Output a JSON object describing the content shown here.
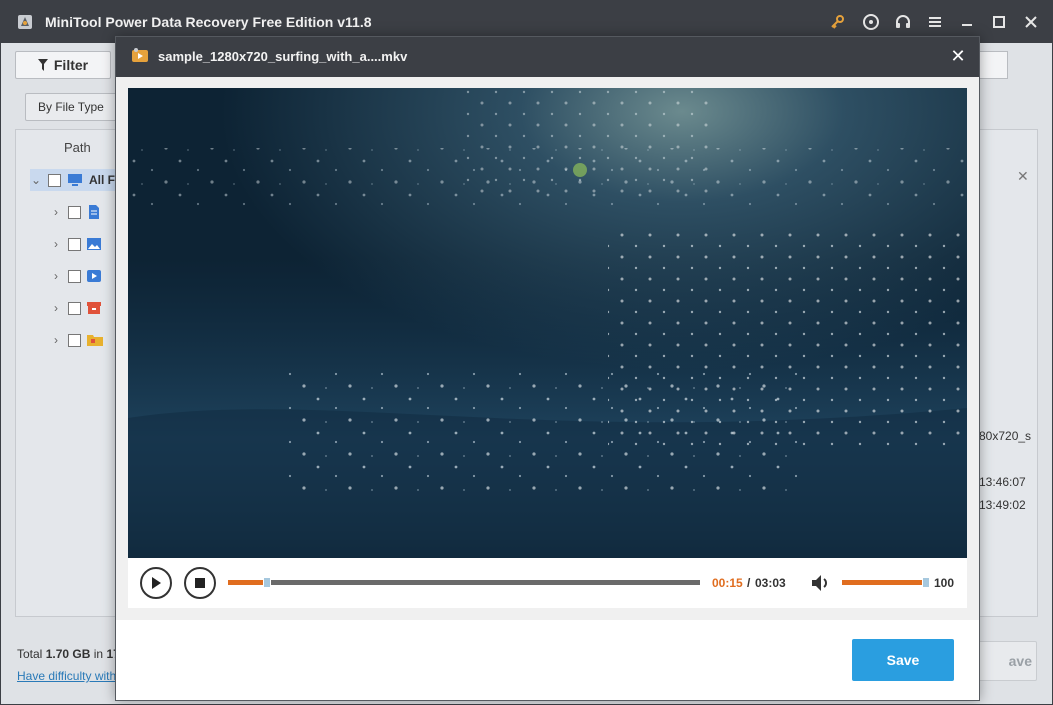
{
  "app": {
    "title": "MiniTool Power Data Recovery Free Edition v11.8",
    "titlebar_icons": [
      "key-icon",
      "disc-icon",
      "headphones-icon",
      "menu-icon",
      "minimize-icon",
      "maximize-icon",
      "close-icon"
    ]
  },
  "background": {
    "filter_label": "Filter",
    "type_dropdown_label": "By File Type",
    "path_header": "Path",
    "tree": [
      {
        "label": "All F",
        "expanded": true,
        "icon": "computer-icon",
        "color": "#3a7bd5"
      },
      {
        "label": "",
        "icon": "document-icon",
        "color": "#3a7bd5"
      },
      {
        "label": "",
        "icon": "picture-icon",
        "color": "#3a7bd5"
      },
      {
        "label": "",
        "icon": "video-icon",
        "color": "#3a7bd5"
      },
      {
        "label": "",
        "icon": "archive-icon",
        "color": "#e0523a"
      },
      {
        "label": "",
        "icon": "folder-icon",
        "color": "#e8b12e"
      }
    ],
    "right_panel": {
      "filename_fragment": "80x720_s",
      "created_time_fragment": "13:46:07",
      "modified_time_fragment": "13:49:02"
    },
    "footer_total_prefix": "Total",
    "footer_total_size": "1.70 GB",
    "footer_total_suffix": "in",
    "footer_total_count_fragment": "17",
    "footer_link": "Have difficulty with",
    "save_fragment": "ave"
  },
  "preview": {
    "file_name": "sample_1280x720_surfing_with_a....mkv",
    "time_current": "00:15",
    "time_separator": "/",
    "time_total": "03:03",
    "progress_fraction": 0.082,
    "volume": "100",
    "volume_fraction": 1.0,
    "save_label": "Save"
  },
  "colors": {
    "titlebar": "#3c3f45",
    "accent_orange": "#e06d1f",
    "save_blue": "#2a9ee0"
  }
}
